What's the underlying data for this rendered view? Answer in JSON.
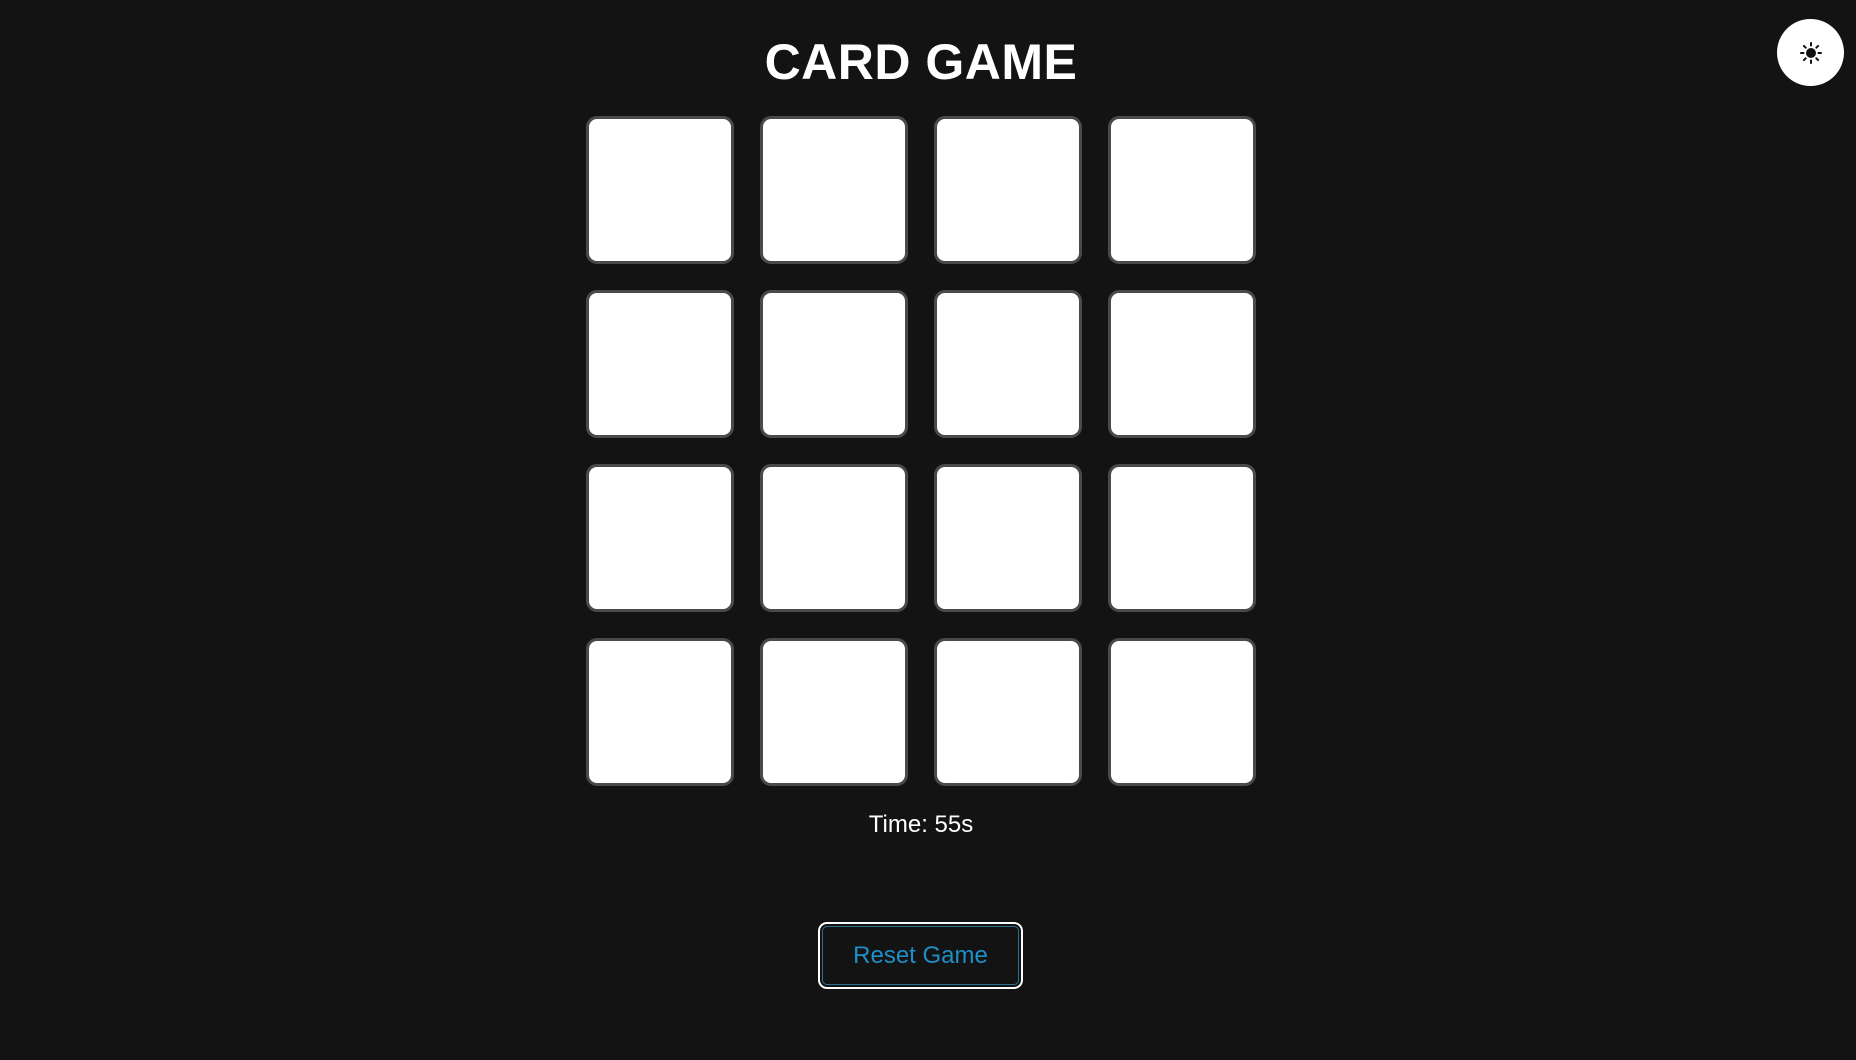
{
  "header": {
    "title": "CARD GAME"
  },
  "theme_toggle": {
    "icon": "sun-icon",
    "background": "#ffffff"
  },
  "board": {
    "rows": 4,
    "columns": 4,
    "cards": [
      {
        "state": "face-down"
      },
      {
        "state": "face-down"
      },
      {
        "state": "face-down"
      },
      {
        "state": "face-down"
      },
      {
        "state": "face-down"
      },
      {
        "state": "face-down"
      },
      {
        "state": "face-down"
      },
      {
        "state": "face-down"
      },
      {
        "state": "face-down"
      },
      {
        "state": "face-down"
      },
      {
        "state": "face-down"
      },
      {
        "state": "face-down"
      },
      {
        "state": "face-down"
      },
      {
        "state": "face-down"
      },
      {
        "state": "face-down"
      },
      {
        "state": "face-down"
      }
    ]
  },
  "status": {
    "timer_text": "Time: 55s"
  },
  "controls": {
    "reset_label": "Reset Game"
  },
  "colors": {
    "background": "#131313",
    "card_face": "#ffffff",
    "card_border": "#4a4a4a",
    "accent": "#1e8fc6"
  }
}
